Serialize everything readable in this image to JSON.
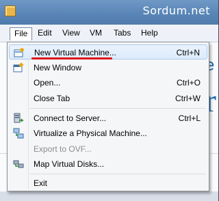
{
  "watermark": "Sordum.net",
  "menubar": {
    "items": [
      "File",
      "Edit",
      "View",
      "VM",
      "Tabs",
      "Help"
    ]
  },
  "file_menu": {
    "items": [
      {
        "label": "New Virtual Machine...",
        "shortcut": "Ctrl+N",
        "icon": "new-vm-icon",
        "highlighted": true
      },
      {
        "label": "New Window",
        "shortcut": "",
        "icon": "new-window-icon"
      },
      {
        "label": "Open...",
        "shortcut": "Ctrl+O"
      },
      {
        "label": "Close Tab",
        "shortcut": "Ctrl+W"
      },
      {
        "label": "Connect to Server...",
        "shortcut": "Ctrl+L",
        "icon": "connect-server-icon"
      },
      {
        "label": "Virtualize a Physical Machine...",
        "shortcut": "",
        "icon": "virtualize-machine-icon"
      },
      {
        "label": "Export to OVF...",
        "shortcut": "",
        "disabled": true
      },
      {
        "label": "Map Virtual Disks...",
        "shortcut": "",
        "icon": "map-disks-icon"
      },
      {
        "label": "Exit",
        "shortcut": ""
      }
    ]
  },
  "colors": {
    "highlight_underline": "#e0141c",
    "hover_background": "#dcebfb",
    "titlebar": "#5a86b7"
  }
}
